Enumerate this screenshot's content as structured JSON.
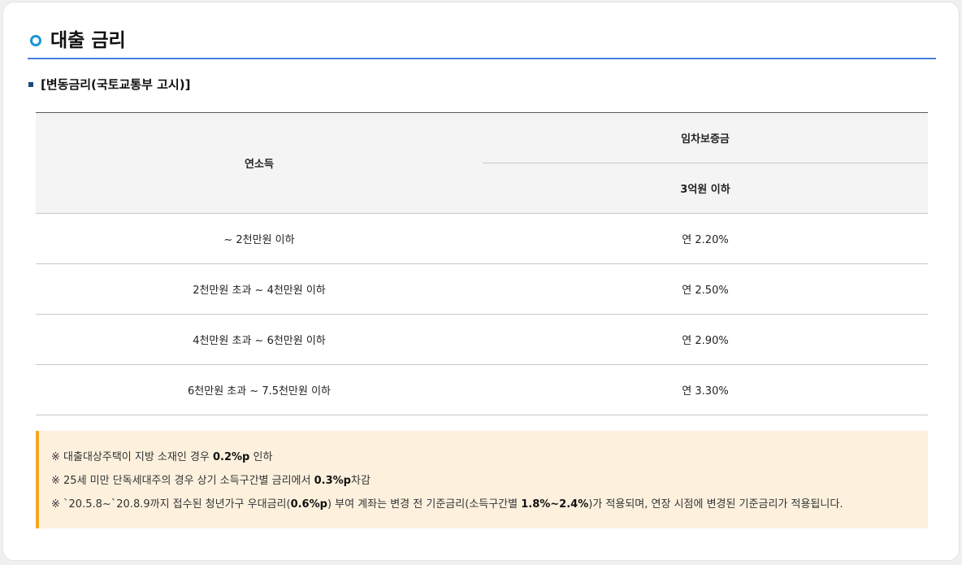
{
  "section": {
    "title": "대출 금리",
    "subtitle": "[변동금리(국토교통부 고시)]"
  },
  "table": {
    "col_income": "연소득",
    "col_deposit": "임차보증금",
    "col_deposit_sub": "3억원 이하",
    "rows": [
      {
        "income": "~ 2천만원 이하",
        "rate": "연 2.20%"
      },
      {
        "income": "2천만원 초과 ~ 4천만원 이하",
        "rate": "연 2.50%"
      },
      {
        "income": "4천만원 초과 ~ 6천만원 이하",
        "rate": "연 2.90%"
      },
      {
        "income": "6천만원 초과 ~ 7.5천만원 이하",
        "rate": "연 3.30%"
      }
    ]
  },
  "notes": {
    "n1_pre": "※ 대출대상주택이 지방 소재인 경우 ",
    "n1_bold": "0.2%p",
    "n1_post": " 인하",
    "n2_pre": "※ 25세 미만 단독세대주의 경우 상기 소득구간별 금리에서 ",
    "n2_bold": "0.3%p",
    "n2_post": "차감",
    "n3_a": "※ `20.5.8~`20.8.9까지 접수된 청년가구 우대금리(",
    "n3_b": "0.6%p",
    "n3_c": ") 부여 계좌는 변경 전 기준금리(소득구간별 ",
    "n3_d": "1.8%~2.4%",
    "n3_e": ")가 적용되며, 연장 시점에 변경된 기준금리가 적용됩니다."
  },
  "colors": {
    "accent_blue": "#1b94d4",
    "header_rule": "#4a7fe0",
    "note_bg": "#fdf1de",
    "note_border": "#f5a623"
  }
}
